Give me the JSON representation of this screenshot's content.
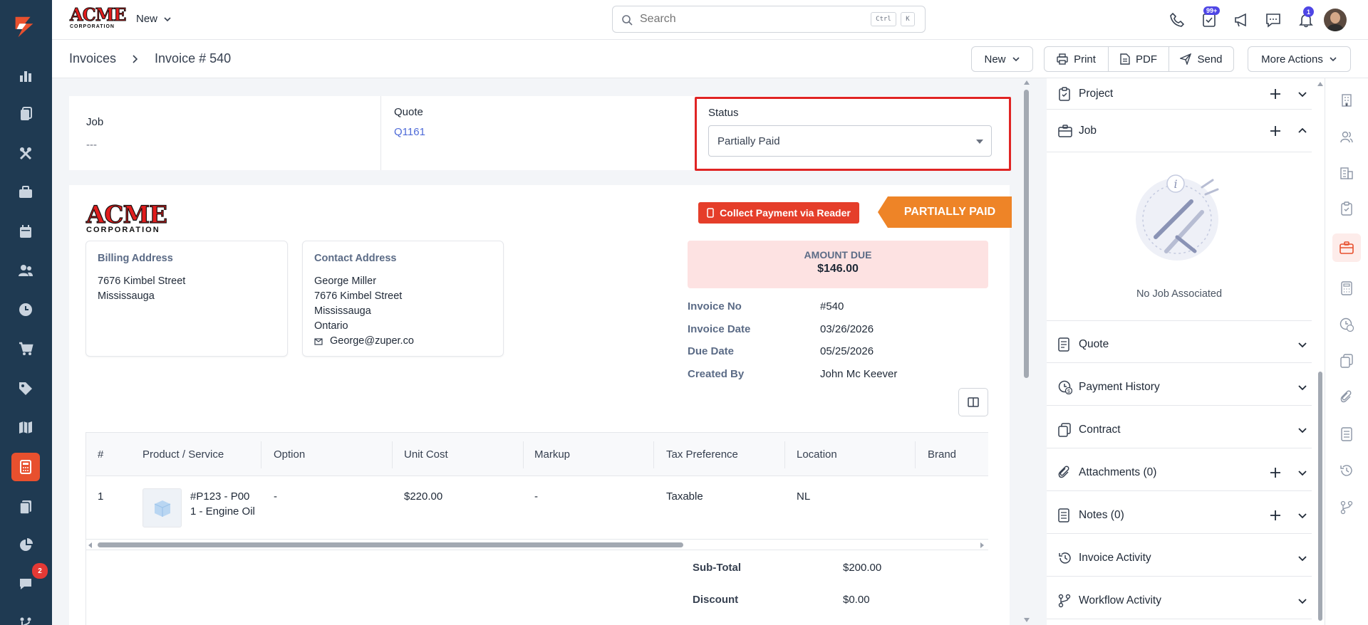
{
  "brand": {
    "logo_top": "ACME",
    "logo_bottom": "CORPORATION"
  },
  "topbar": {
    "new_label": "New",
    "search_placeholder": "Search",
    "kbd_ctrl": "Ctrl",
    "kbd_k": "K",
    "tasks_badge": "99+",
    "notifications_badge": "1"
  },
  "leftnav": {
    "chat_badge": "2"
  },
  "breadcrumb": {
    "root": "Invoices",
    "current": "Invoice # 540"
  },
  "toolbar": {
    "new_label": "New",
    "print_label": "Print",
    "pdf_label": "PDF",
    "send_label": "Send",
    "more_label": "More Actions"
  },
  "meta": {
    "job_label": "Job",
    "job_value": "---",
    "quote_label": "Quote",
    "quote_value": "Q1161",
    "status_label": "Status",
    "status_value": "Partially Paid"
  },
  "invoice": {
    "collect_label": "Collect Payment via Reader",
    "status_ribbon": "PARTIALLY PAID",
    "amount_due_label": "AMOUNT DUE",
    "amount_due_value": "$146.00",
    "billing": {
      "heading": "Billing Address",
      "line1": "7676 Kimbel Street",
      "line2": "Mississauga"
    },
    "contact": {
      "heading": "Contact Address",
      "name": "George Miller",
      "line1": "7676 Kimbel Street",
      "line2": "Mississauga",
      "line3": "Ontario",
      "email": "George@zuper.co"
    },
    "info": [
      {
        "key": "Invoice No",
        "value": "#540"
      },
      {
        "key": "Invoice Date",
        "value": "03/26/2026"
      },
      {
        "key": "Due Date",
        "value": "05/25/2026"
      },
      {
        "key": "Created By",
        "value": "John Mc Keever"
      }
    ],
    "table": {
      "headers": [
        "#",
        "Product / Service",
        "Option",
        "Unit Cost",
        "Markup",
        "Tax Preference",
        "Location",
        "Brand"
      ],
      "rows": [
        {
          "num": "1",
          "product_line1": "#P123 - P00",
          "product_line2": "1 - Engine Oil",
          "option": "-",
          "unit_cost": "$220.00",
          "markup": "-",
          "tax": "Taxable",
          "location": "NL",
          "brand": ""
        }
      ]
    },
    "totals": [
      {
        "key": "Sub-Total",
        "value": "$200.00"
      },
      {
        "key": "Discount",
        "value": "$0.00"
      }
    ]
  },
  "rightpanel": {
    "sections": [
      {
        "label": "Project",
        "icon": "clipboard-check-icon"
      },
      {
        "label": "Job",
        "icon": "briefcase-icon"
      },
      {
        "label": "Quote",
        "icon": "document-icon"
      },
      {
        "label": "Payment History",
        "icon": "payment-clock-icon"
      },
      {
        "label": "Contract",
        "icon": "copy-icon"
      },
      {
        "label": "Attachments (0)",
        "icon": "paperclip-icon"
      },
      {
        "label": "Notes (0)",
        "icon": "notes-icon"
      },
      {
        "label": "Invoice Activity",
        "icon": "history-icon"
      },
      {
        "label": "Workflow Activity",
        "icon": "workflow-icon"
      }
    ],
    "job_empty_text": "No Job Associated"
  },
  "colors": {
    "nav_bg": "#1f3a52",
    "accent_orange": "#e8502e",
    "ribbon_orange": "#ee8427",
    "collect_red": "#e53e2a",
    "amount_due_bg": "#fde2e2",
    "link_blue": "#4f6bd8",
    "highlight_red": "#e02424"
  }
}
